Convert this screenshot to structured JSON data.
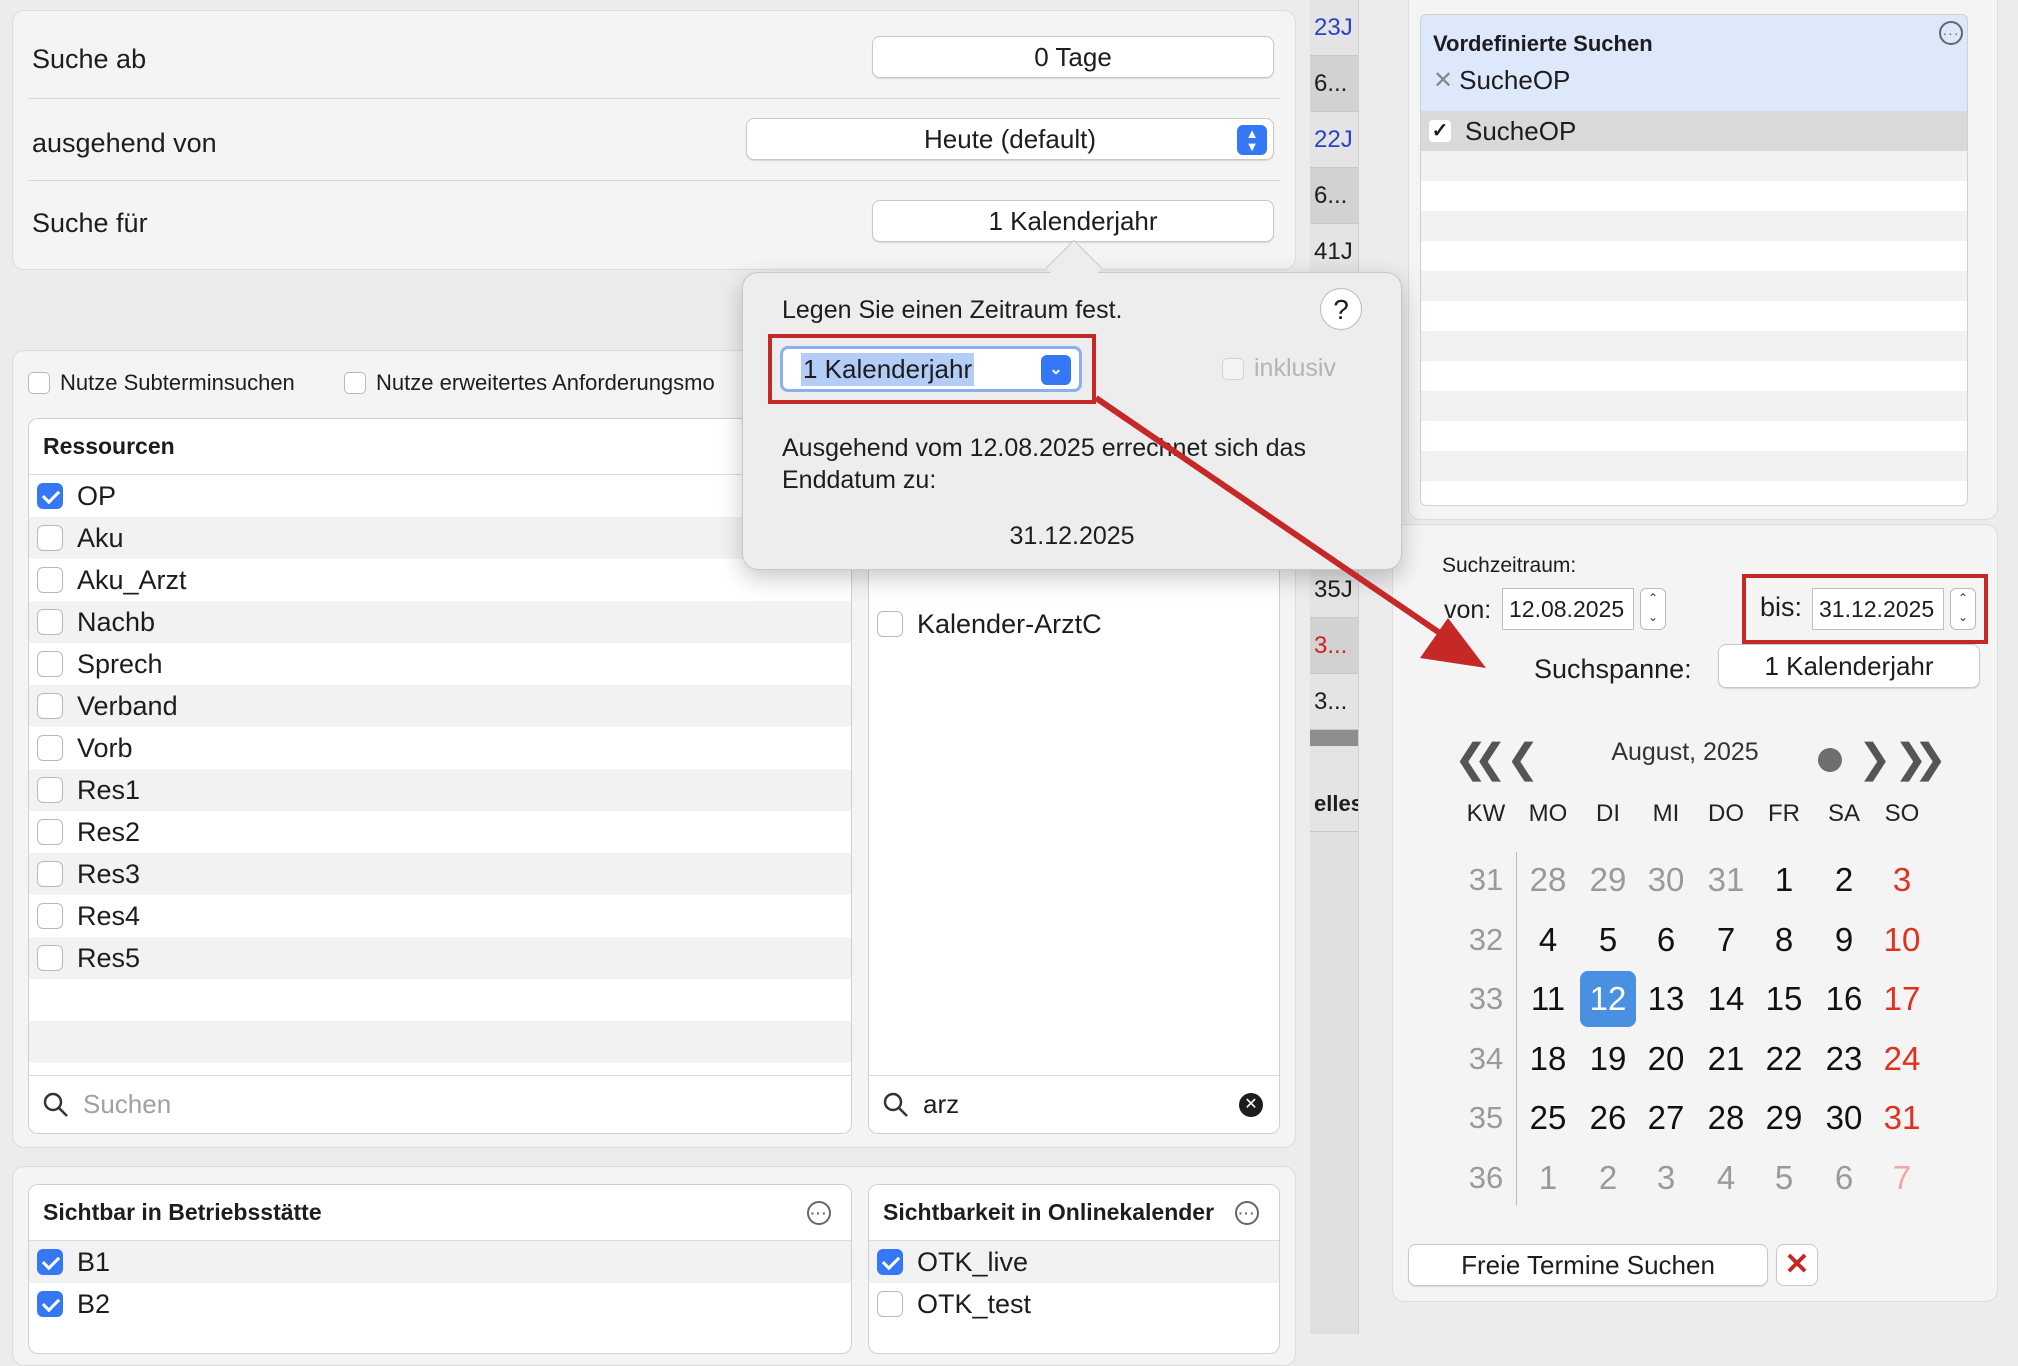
{
  "top": {
    "suche_ab_label": "Suche ab",
    "suche_ab_value": "0 Tage",
    "ausgehend_label": "ausgehend von",
    "ausgehend_value": "Heute (default)",
    "suche_fuer_label": "Suche für",
    "suche_fuer_value": "1 Kalenderjahr"
  },
  "options": {
    "subtermin": "Nutze Subterminsuchen",
    "erweitert": "Nutze erweitertes Anforderungsmo"
  },
  "resources": {
    "header": "Ressourcen",
    "items": [
      {
        "label": "OP",
        "checked": true
      },
      {
        "label": "Aku",
        "checked": false
      },
      {
        "label": "Aku_Arzt",
        "checked": false
      },
      {
        "label": "Nachb",
        "checked": false
      },
      {
        "label": "Sprech",
        "checked": false
      },
      {
        "label": "Verband",
        "checked": false
      },
      {
        "label": "Vorb",
        "checked": false
      },
      {
        "label": "Res1",
        "checked": false
      },
      {
        "label": "Res2",
        "checked": false
      },
      {
        "label": "Res3",
        "checked": false
      },
      {
        "label": "Res4",
        "checked": false
      },
      {
        "label": "Res5",
        "checked": false
      }
    ],
    "search_placeholder": "Suchen"
  },
  "second_list": {
    "item": "Kalender-ArztC",
    "search_value": "arz"
  },
  "betriebsstaette": {
    "header": "Sichtbar in Betriebsstätte",
    "items": [
      {
        "label": "B1",
        "checked": true
      },
      {
        "label": "B2",
        "checked": true
      }
    ]
  },
  "onlinekalender": {
    "header": "Sichtbarkeit in Onlinekalender",
    "items": [
      {
        "label": "OTK_live",
        "checked": true
      },
      {
        "label": "OTK_test",
        "checked": false
      }
    ]
  },
  "strip": {
    "top": [
      "23J",
      "6...",
      "22J",
      "6...",
      "41J"
    ],
    "bottom": [
      "35J",
      "3...",
      "3..."
    ],
    "footer": "elles"
  },
  "popover": {
    "title": "Legen Sie einen Zeitraum fest.",
    "help": "?",
    "select_value": "1 Kalenderjahr",
    "inklusiv": "inklusiv",
    "desc": "Ausgehend vom 12.08.2025 errechnet sich das Enddatum zu:",
    "result": "31.12.2025"
  },
  "predefined": {
    "header": "Vordefinierte Suchen",
    "tag": "SucheOP",
    "selected": "SucheOP"
  },
  "suchzeitraum": {
    "label": "Suchzeitraum:",
    "von_label": "von:",
    "von_value": "12.08.2025",
    "bis_label": "bis:",
    "bis_value": "31.12.2025",
    "spanne_label": "Suchspanne:",
    "spanne_value": "1 Kalenderjahr"
  },
  "calendar": {
    "month": "August, 2025",
    "headers": [
      "KW",
      "MO",
      "DI",
      "MI",
      "DO",
      "FR",
      "SA",
      "SO"
    ],
    "weeks": [
      {
        "kw": "31",
        "days": [
          "28",
          "29",
          "30",
          "31",
          "1",
          "2",
          "3"
        ]
      },
      {
        "kw": "32",
        "days": [
          "4",
          "5",
          "6",
          "7",
          "8",
          "9",
          "10"
        ]
      },
      {
        "kw": "33",
        "days": [
          "11",
          "12",
          "13",
          "14",
          "15",
          "16",
          "17"
        ]
      },
      {
        "kw": "34",
        "days": [
          "18",
          "19",
          "20",
          "21",
          "22",
          "23",
          "24"
        ]
      },
      {
        "kw": "35",
        "days": [
          "25",
          "26",
          "27",
          "28",
          "29",
          "30",
          "31"
        ]
      },
      {
        "kw": "36",
        "days": [
          "1",
          "2",
          "3",
          "4",
          "5",
          "6",
          "7"
        ]
      }
    ],
    "selected_day": "12"
  },
  "actions": {
    "search_button": "Freie Termine Suchen",
    "cancel": "✕"
  },
  "colors": {
    "accent": "#3478f6",
    "annotation": "#c62828",
    "weekend": "#e0301e"
  }
}
